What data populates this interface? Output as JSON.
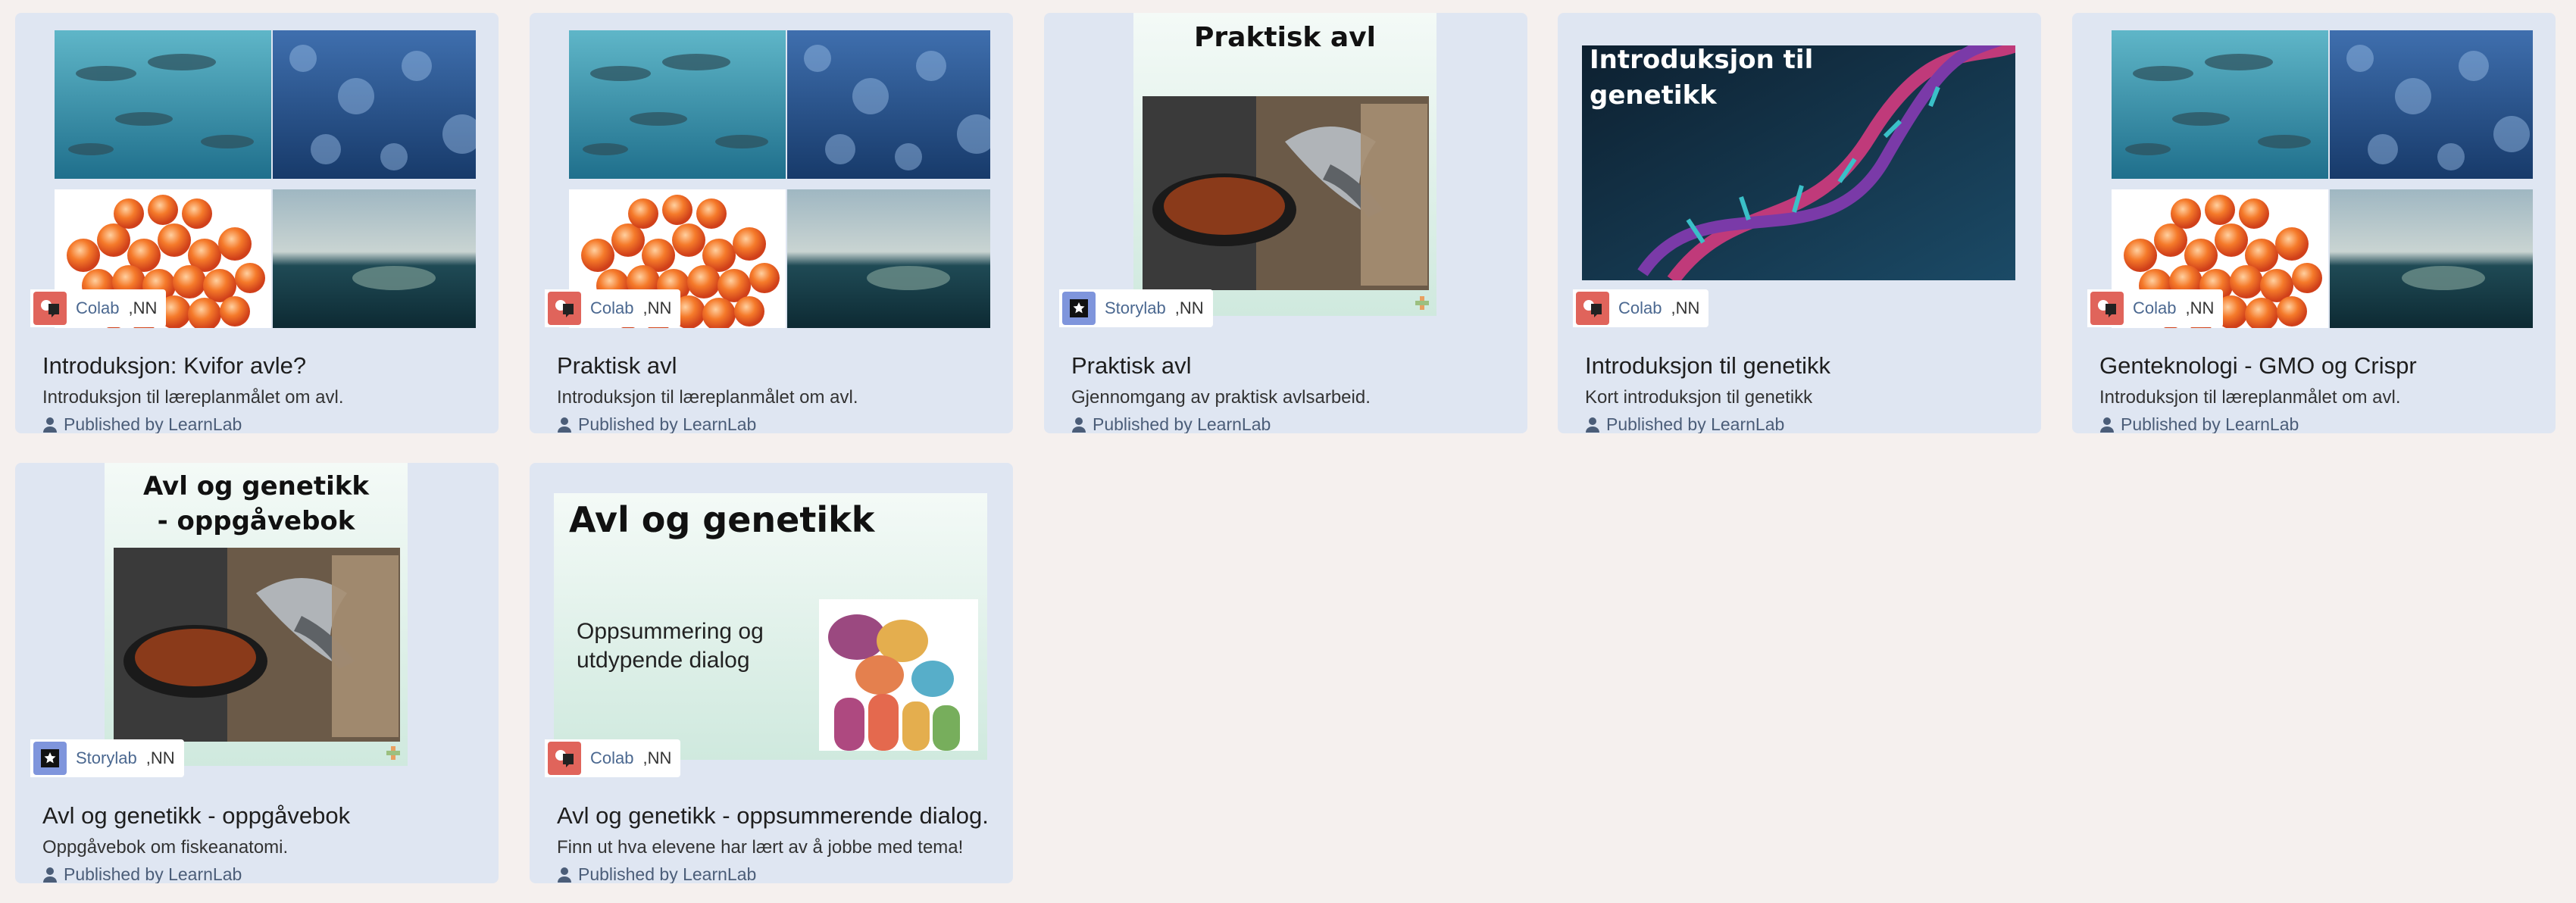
{
  "cards": [
    {
      "title": "Introduksjon: Kvifor avle?",
      "description": "Introduksjon til læreplanmålet om avl.",
      "published": "Published by LearnLab",
      "type": "Colab",
      "lang": ",NN",
      "image": "fish-collage"
    },
    {
      "title": "Praktisk avl",
      "description": "Introduksjon til læreplanmålet om avl.",
      "published": "Published by LearnLab",
      "type": "Colab",
      "lang": ",NN",
      "image": "fish-collage"
    },
    {
      "title": "Praktisk avl",
      "description": "Gjennomgang av praktisk avlsarbeid.",
      "published": "Published by LearnLab",
      "type": "Storylab",
      "lang": ",NN",
      "image": "storylab-slide",
      "slide_title": "Praktisk avl"
    },
    {
      "title": "Introduksjon til genetikk",
      "description": "Kort introduksjon til genetikk",
      "published": "Published by LearnLab",
      "type": "Colab",
      "lang": ",NN",
      "image": "dna-helix",
      "slide_title": "Introduksjon til genetikk"
    },
    {
      "title": "Genteknologi - GMO og Crispr",
      "description": "Introduksjon til læreplanmålet om avl.",
      "published": "Published by LearnLab",
      "type": "Colab",
      "lang": ",NN",
      "image": "fish-collage"
    },
    {
      "title": "Avl og genetikk - oppgåvebok",
      "description": "Oppgåvebok om fiskeanatomi.",
      "published": "Published by LearnLab",
      "type": "Storylab",
      "lang": ",NN",
      "image": "storylab-slide",
      "slide_title_1": "Avl og genetikk",
      "slide_title_2": "- oppgåvebok"
    },
    {
      "title": "Avl og genetikk - oppsummerende dialog.",
      "description": "Finn ut hva elevene har lært av å jobbe med tema!",
      "published": "Published by LearnLab",
      "type": "Colab",
      "lang": ",NN",
      "image": "dialog-slide",
      "slide_title": "Avl og genetikk",
      "slide_sub_1": "Oppsummering og",
      "slide_sub_2": "utdypende dialog"
    }
  ],
  "colors": {
    "background": "#f5f0ee",
    "card": "#dfe6f2",
    "colab": "#e0645b",
    "storylab": "#7f95dc",
    "link": "#4b6890"
  }
}
